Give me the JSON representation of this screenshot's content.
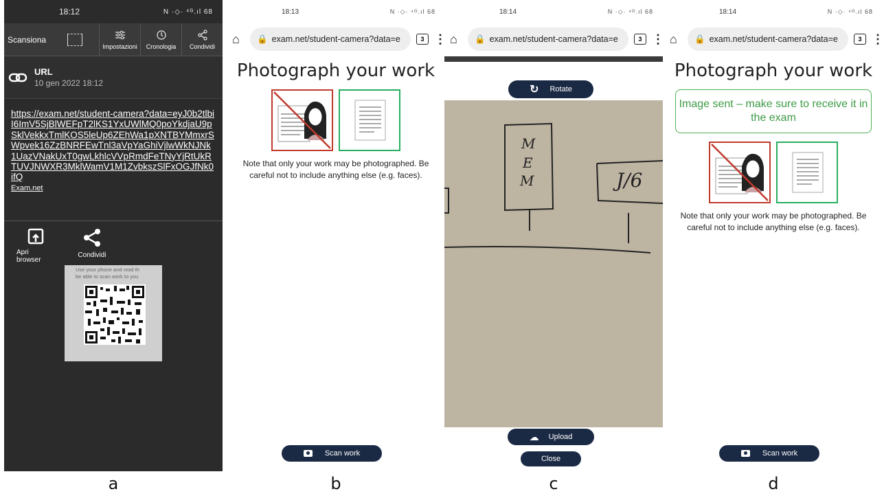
{
  "captions": [
    "a",
    "b",
    "c",
    "d"
  ],
  "panel_a": {
    "time": "18:12",
    "status_icons": "N ·◇· ⁴ᴳ.ıl 68",
    "toolbar": {
      "scan_label": "Scansiona",
      "actions": [
        "Impostazioni",
        "Cronologia",
        "Condividi"
      ]
    },
    "header": {
      "type": "URL",
      "date": "10 gen 2022 18:12"
    },
    "link_text": "https://exam.net/student-camera?data=eyJ0b2tlbiI6ImV5SjBlWEFpT2lKS1YxUWlMQ0poYkdjaU9pSklVekkxTmlKOS5leUp6ZEhWa1pXNTBYMmxrSWpvek16ZzBNRFEwTnl3aVpYaGhiVjlwWkNJNk1UazVNakUxT0gwLkhlcVVpRmdFeTNyYjRtUkRTUVJNWXR3MklWamV1M1ZvbkszSlFxOGJfNk0ifQ",
    "sublink": "Exam.net",
    "buttons": [
      "Apri browser",
      "Condividi"
    ],
    "qr_caption_lines": [
      "Use your phone and read th",
      "be able to scan work to you"
    ]
  },
  "panel_b": {
    "time": "18:13",
    "status_icons": "N ·◇· ⁴ᴳ.ıl 68",
    "url": "exam.net/student-camera?data=e",
    "tab_count": "3",
    "title": "Photograph your work",
    "note": "Note that only your work may be photographed. Be careful not to include anything else (e.g. faces).",
    "scan_button": "Scan work"
  },
  "panel_c": {
    "time": "18:14",
    "status_icons": "N ·◇· ⁴ᴳ.ıl 68",
    "url": "exam.net/student-camera?data=e",
    "tab_count": "3",
    "rotate_button": "Rotate",
    "upload_button": "Upload",
    "close_button": "Close",
    "handwriting": [
      "M",
      "E",
      "M",
      "J/6"
    ]
  },
  "panel_d": {
    "time": "18:14",
    "status_icons": "N ·◇· ⁴ᴳ.ıl 68",
    "url": "exam.net/student-camera?data=e",
    "tab_count": "3",
    "title": "Photograph your work",
    "sent_message": "Image sent – make sure to receive it in the exam",
    "note": "Note that only your work may be photographed. Be careful not to include anything else (e.g. faces).",
    "scan_button": "Scan work"
  }
}
